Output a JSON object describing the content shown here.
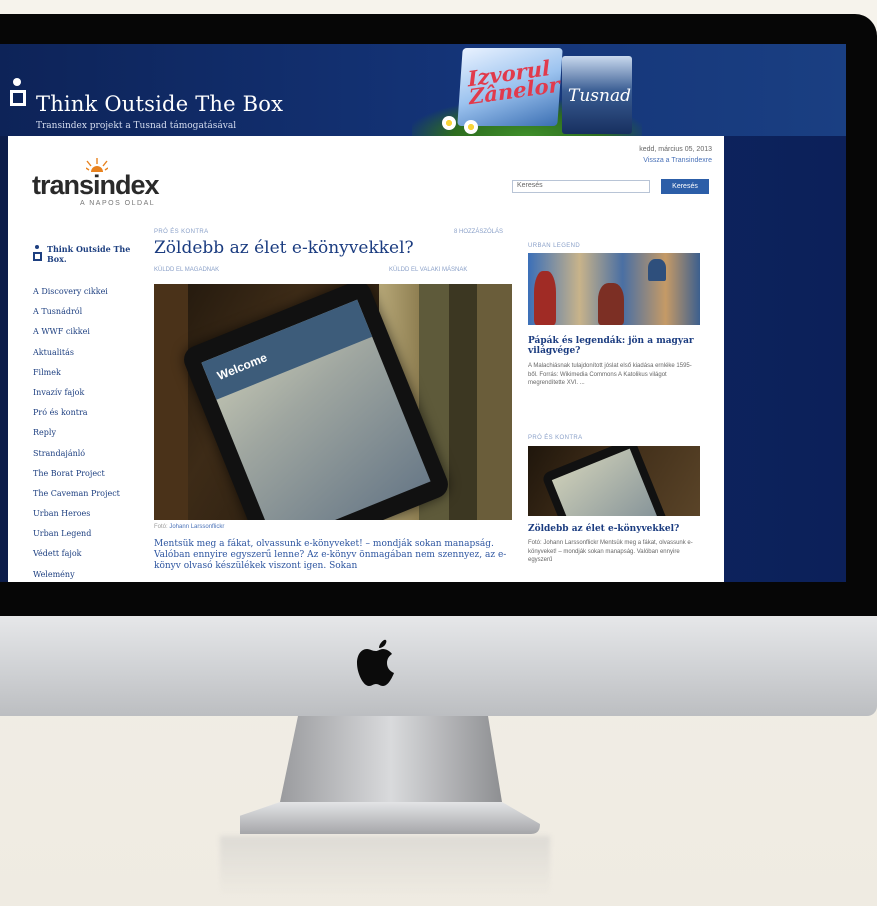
{
  "banner": {
    "title": "Think Outside The Box",
    "subtitle": "Transindex projekt a Tusnad támogatásával",
    "promo_pack_text": "Izvorul Zânelor",
    "promo_brand": "Tusnad"
  },
  "header": {
    "date": "kedd, március 05, 2013",
    "back_link": "Vissza a Transindexre",
    "logo": "transindex",
    "logo_tagline": "A NAPOS OLDAL",
    "search_placeholder": "Keresés",
    "search_button": "Keresés"
  },
  "sidebar": {
    "heading": "Think Outside The Box.",
    "items": [
      {
        "label": "A Discovery cikkei"
      },
      {
        "label": "A Tusnádról"
      },
      {
        "label": "A WWF cikkei"
      },
      {
        "label": "Aktualitás"
      },
      {
        "label": "Filmek"
      },
      {
        "label": "Invazív fajok"
      },
      {
        "label": "Pró és kontra"
      },
      {
        "label": "Reply"
      },
      {
        "label": "Strandajánló"
      },
      {
        "label": "The Borat Project"
      },
      {
        "label": "The Caveman Project"
      },
      {
        "label": "Urban Heroes"
      },
      {
        "label": "Urban Legend"
      },
      {
        "label": "Védett fajok"
      },
      {
        "label": "Welemény"
      }
    ]
  },
  "article": {
    "kicker": "PRÓ ÉS KONTRA",
    "comments": "8 HOZZÁSZÓLÁS",
    "headline": "Zöldebb az élet e-könyvekkel?",
    "byline_left": "KÜLDD EL MAGADNAK",
    "byline_right": "KÜLDD EL VALAKI MÁSNAK",
    "image_text": "Welcome",
    "caption_prefix": "Fotó: ",
    "caption_author": "Johann Larssonflickr",
    "lead": "Mentsük meg a fákat, olvassunk e-könyveket! – mondják sokan manapság. Valóban ennyire egyszerű lenne? Az e-könyv önmagában nem szennyez, az e-könyv olvasó készülékek viszont igen. Sokan"
  },
  "right_column": {
    "item1": {
      "kicker": "URBAN LEGEND",
      "headline": "Pápák és legendák: jön a magyar világvége?",
      "text": "A Malachiásnak tulajdonított jóslat első kiadása ernléke 1595-ből. Forrás: Wikimedia Commons A Katolikus világot megrendítette XVI. ..."
    },
    "item2": {
      "kicker": "PRÓ ÉS KONTRA",
      "headline": "Zöldebb az élet e-könyvekkel?",
      "text": "Fotó: Johann Larssonflickr Mentsük meg a fákat, olvassunk e-könyveket! – mondják sokan manapság. Valóban ennyire egyszerű"
    }
  }
}
